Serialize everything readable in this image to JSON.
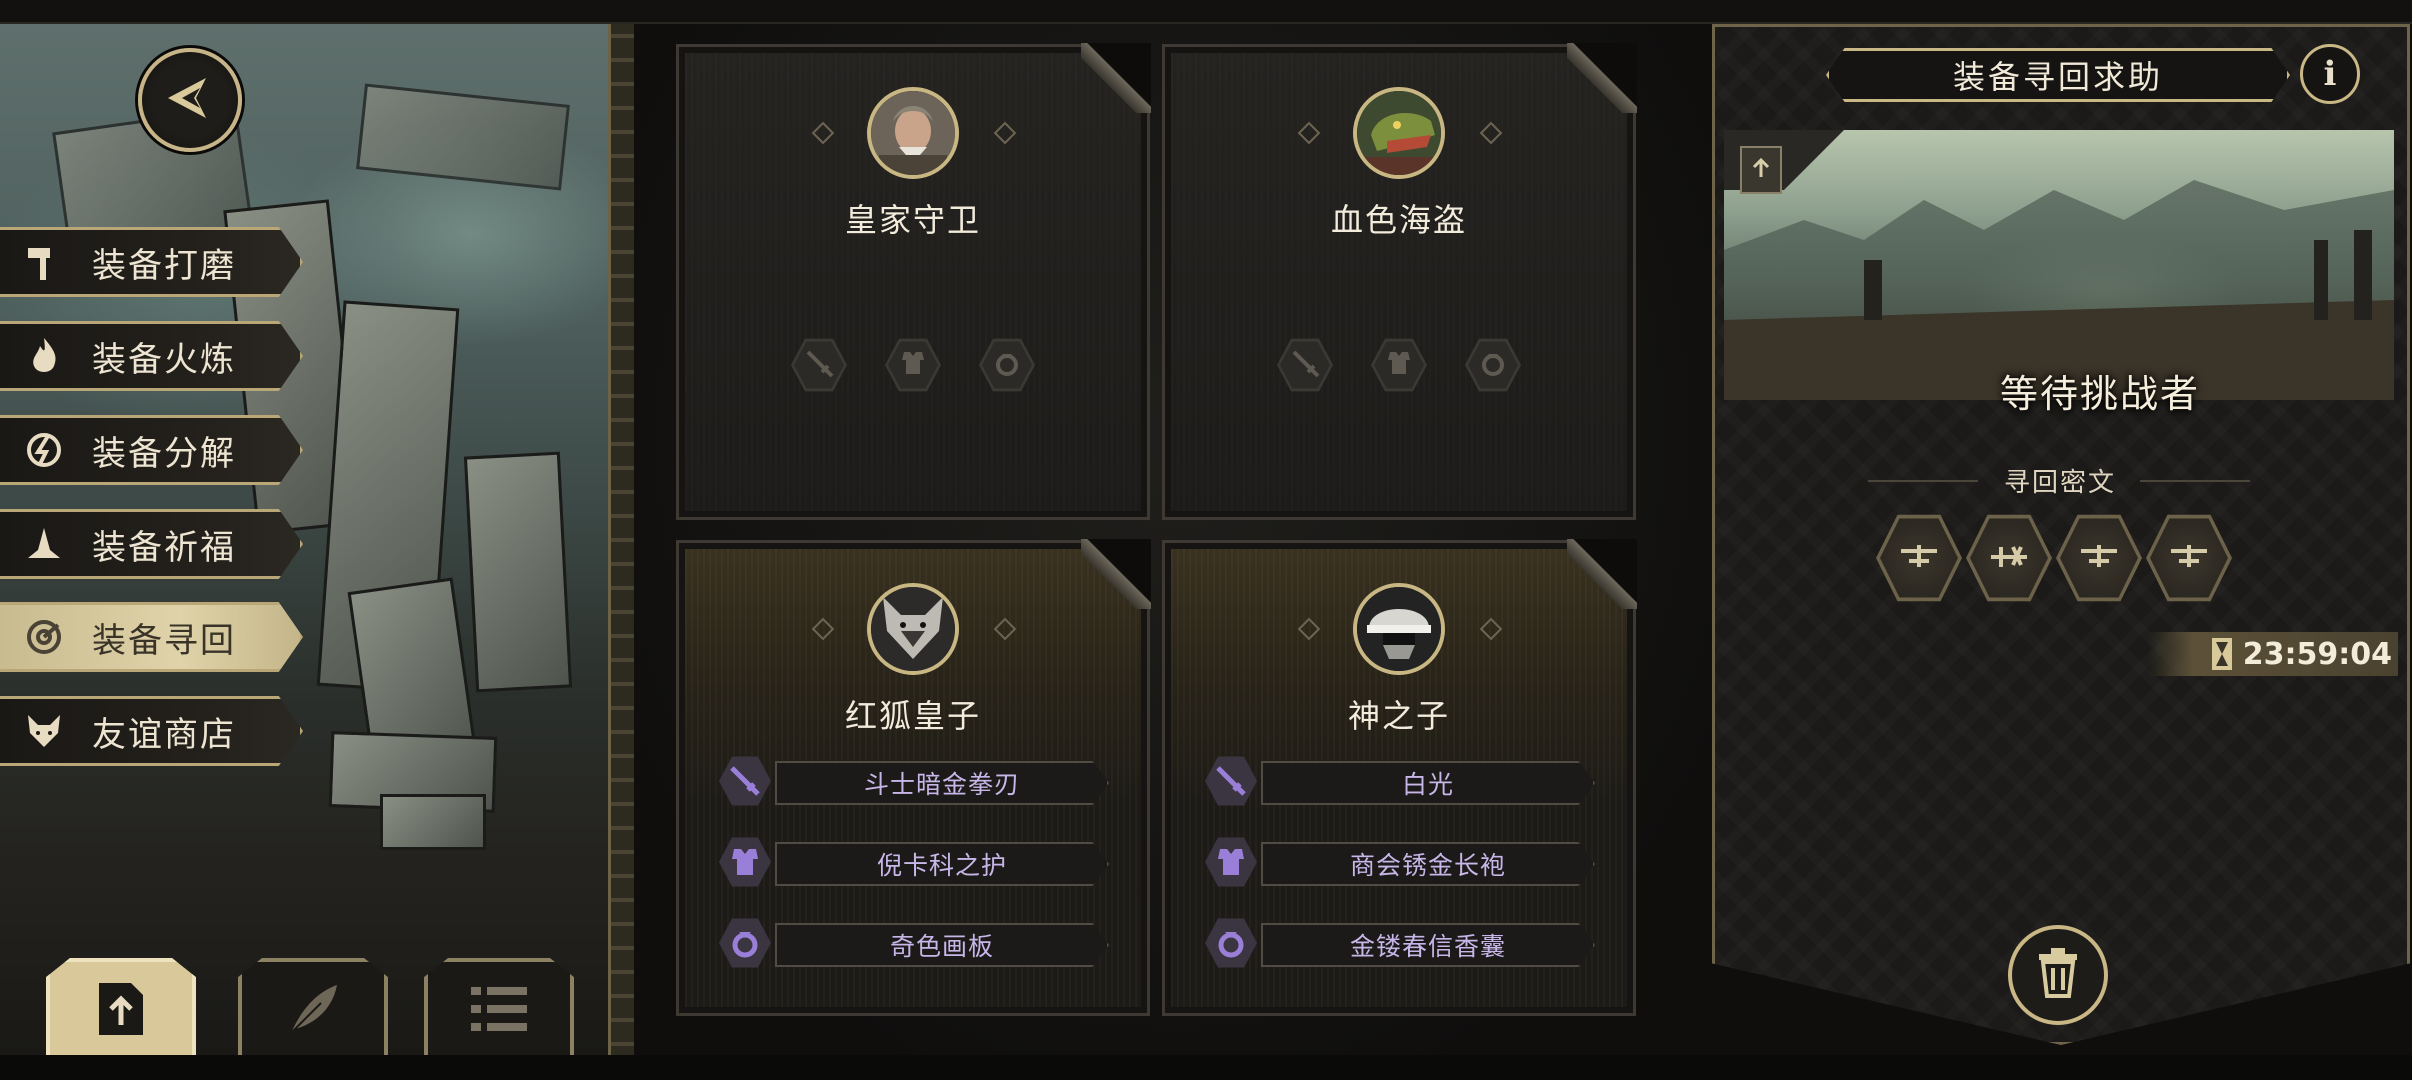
{
  "left_menu": {
    "items": [
      {
        "label": "装备打磨",
        "icon": "hammer-icon",
        "active": false
      },
      {
        "label": "装备火炼",
        "icon": "flame-icon",
        "active": false
      },
      {
        "label": "装备分解",
        "icon": "decompose-icon",
        "active": false
      },
      {
        "label": "装备祈福",
        "icon": "prayer-hands-icon",
        "active": false
      },
      {
        "label": "装备寻回",
        "icon": "target-icon",
        "active": true
      },
      {
        "label": "友谊商店",
        "icon": "fox-icon",
        "active": false
      }
    ],
    "bottom_tabs": [
      {
        "icon": "upload-file-icon",
        "active": true
      },
      {
        "icon": "feather-icon",
        "active": false
      },
      {
        "icon": "list-icon",
        "active": false
      }
    ]
  },
  "cards": [
    {
      "name": "皇家守卫",
      "portrait": "royal-guard-portrait",
      "equipment": []
    },
    {
      "name": "血色海盗",
      "portrait": "crimson-pirate-portrait",
      "equipment": []
    },
    {
      "name": "红狐皇子",
      "portrait": "red-fox-prince-portrait",
      "equipment": [
        "斗士暗金拳刃",
        "倪卡科之护",
        "奇色画板"
      ]
    },
    {
      "name": "神之子",
      "portrait": "son-of-god-portrait",
      "equipment": [
        "白光",
        "商会锈金长袍",
        "金镂春信香囊"
      ]
    }
  ],
  "right_panel": {
    "title": "装备寻回求助",
    "info_label": "i",
    "status": "等待挑战者",
    "runes_label": "寻回密文",
    "timer": "23:59:04"
  },
  "colors": {
    "gold_border": "#c9b785",
    "equipment_text": "#c7b6e8",
    "equipment_icon": "#9a7fd8"
  }
}
